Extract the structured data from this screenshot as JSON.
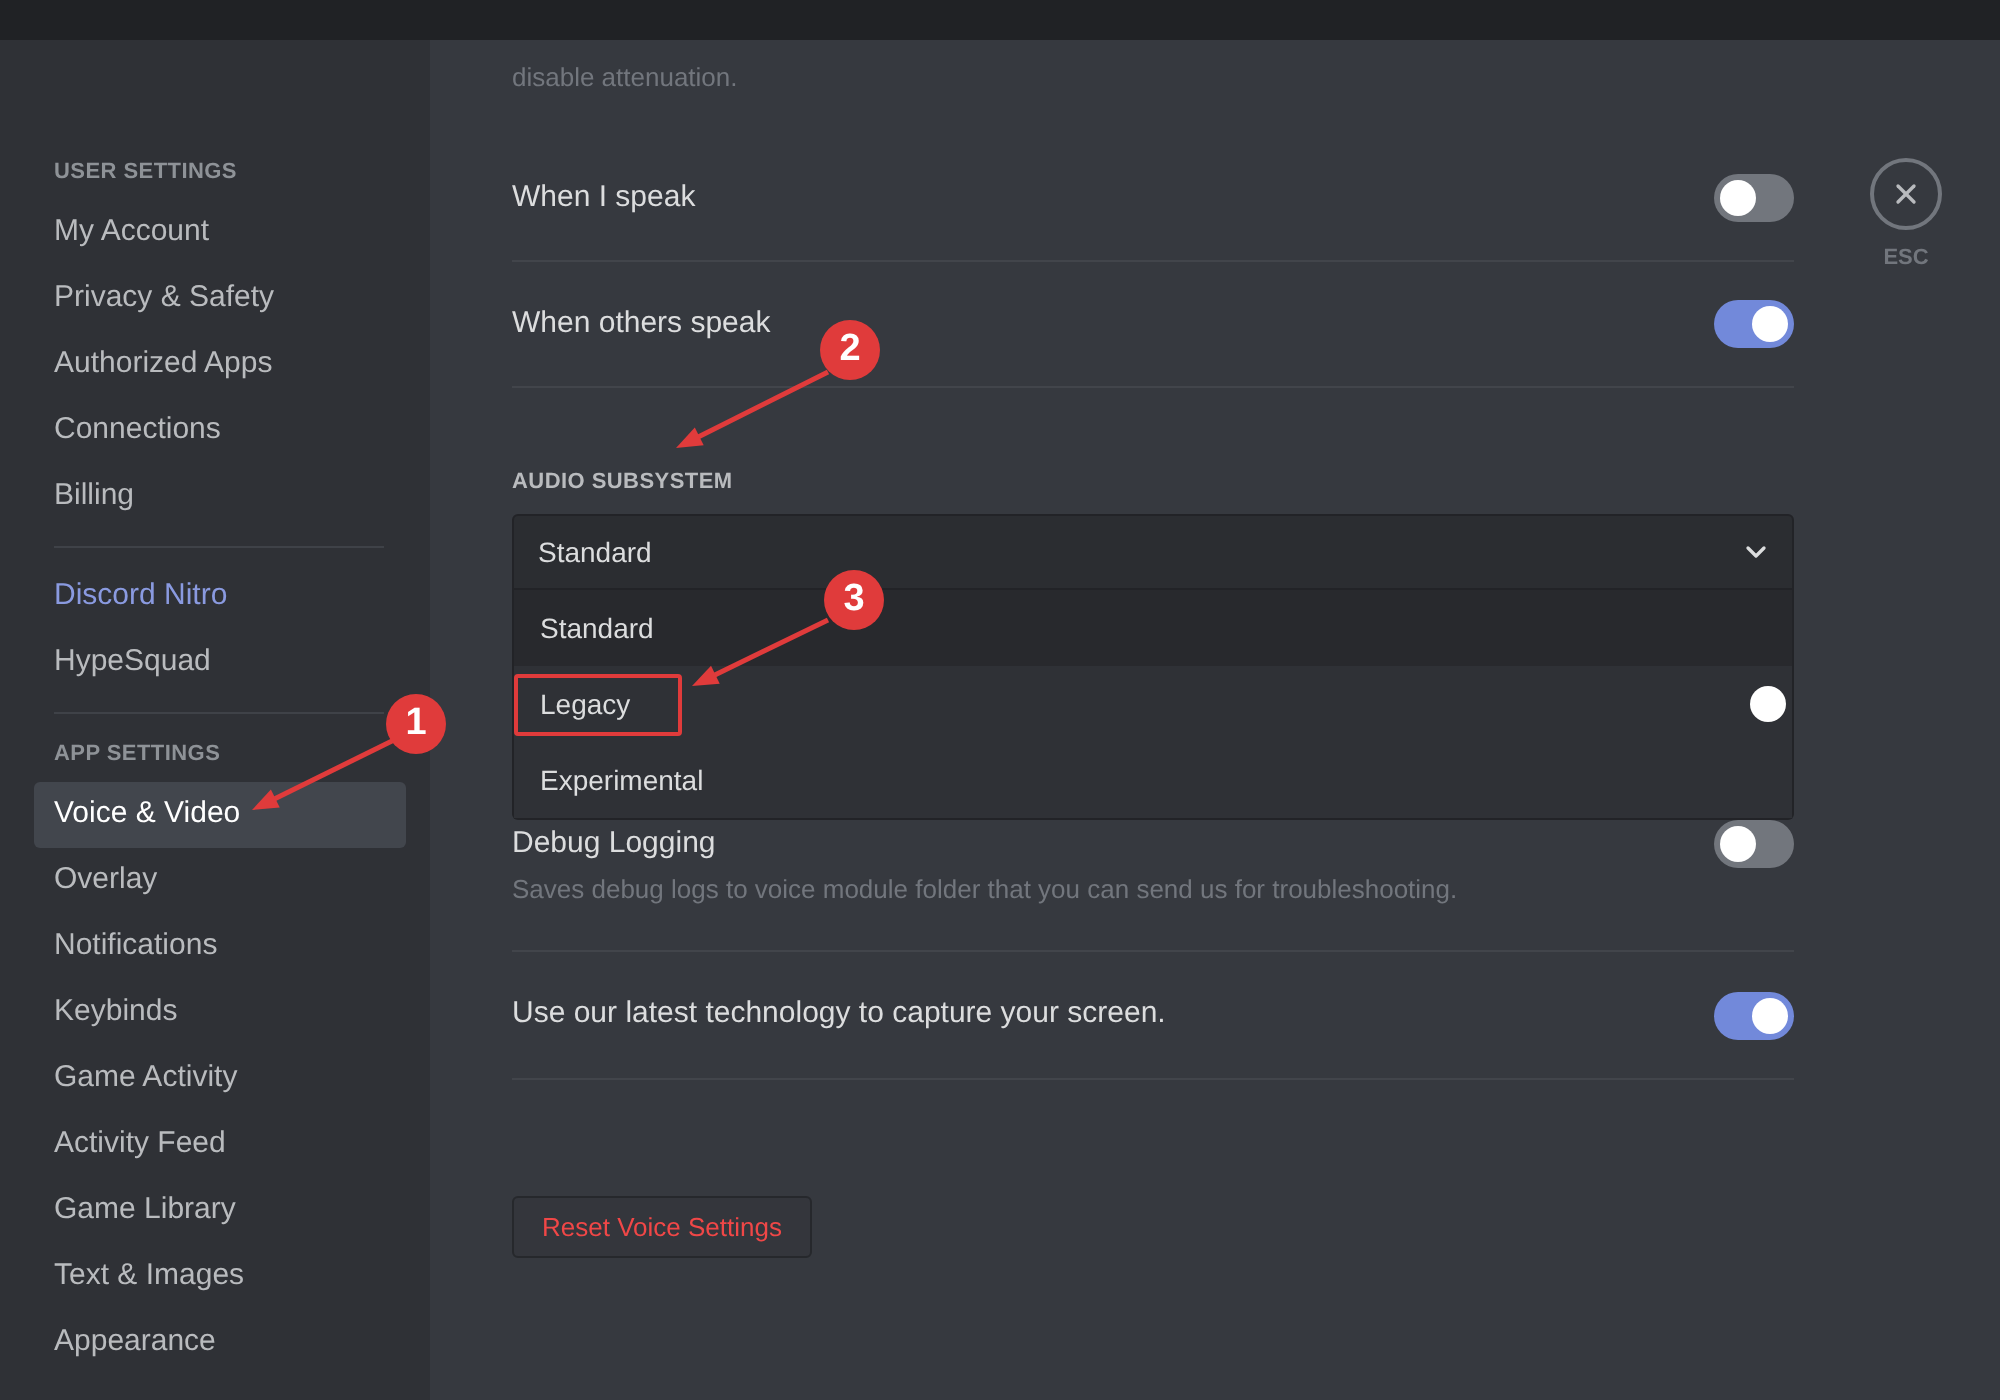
{
  "sidebar": {
    "groups": [
      {
        "header": "USER SETTINGS",
        "items": [
          {
            "label": "My Account",
            "kind": "link",
            "selected": false
          },
          {
            "label": "Privacy & Safety",
            "kind": "link",
            "selected": false
          },
          {
            "label": "Authorized Apps",
            "kind": "link",
            "selected": false
          },
          {
            "label": "Connections",
            "kind": "link",
            "selected": false
          },
          {
            "label": "Billing",
            "kind": "link",
            "selected": false
          }
        ]
      },
      {
        "items": [
          {
            "label": "Discord Nitro",
            "kind": "accent",
            "selected": false
          },
          {
            "label": "HypeSquad",
            "kind": "link",
            "selected": false
          }
        ]
      },
      {
        "header": "APP SETTINGS",
        "items": [
          {
            "label": "Voice & Video",
            "kind": "link",
            "selected": true
          },
          {
            "label": "Overlay",
            "kind": "link",
            "selected": false
          },
          {
            "label": "Notifications",
            "kind": "link",
            "selected": false
          },
          {
            "label": "Keybinds",
            "kind": "link",
            "selected": false
          },
          {
            "label": "Game Activity",
            "kind": "link",
            "selected": false
          },
          {
            "label": "Activity Feed",
            "kind": "link",
            "selected": false
          },
          {
            "label": "Game Library",
            "kind": "link",
            "selected": false
          },
          {
            "label": "Text & Images",
            "kind": "link",
            "selected": false
          },
          {
            "label": "Appearance",
            "kind": "link",
            "selected": false
          }
        ]
      }
    ]
  },
  "content": {
    "attenuation_description": "disable attenuation.",
    "attenuation_toggles": [
      {
        "label": "When I speak",
        "on": false
      },
      {
        "label": "When others speak",
        "on": true
      }
    ],
    "audio_subsystem": {
      "label": "AUDIO SUBSYSTEM",
      "value": "Standard",
      "expanded": true,
      "options": [
        {
          "label": "Standard",
          "selected": true,
          "highlighted": false
        },
        {
          "label": "Legacy",
          "selected": false,
          "highlighted": true
        },
        {
          "label": "Experimental",
          "selected": false,
          "highlighted": false
        }
      ]
    },
    "debug_logging": {
      "label": "Debug Logging",
      "description": "Saves debug logs to voice module folder that you can send us for troubleshooting.",
      "on": false
    },
    "screen_capture": {
      "label": "Use our latest technology to capture your screen.",
      "on": true
    },
    "reset_button": "Reset Voice Settings"
  },
  "close_button": {
    "label": "ESC"
  },
  "callouts": [
    {
      "label": "1"
    },
    {
      "label": "2"
    },
    {
      "label": "3"
    }
  ]
}
